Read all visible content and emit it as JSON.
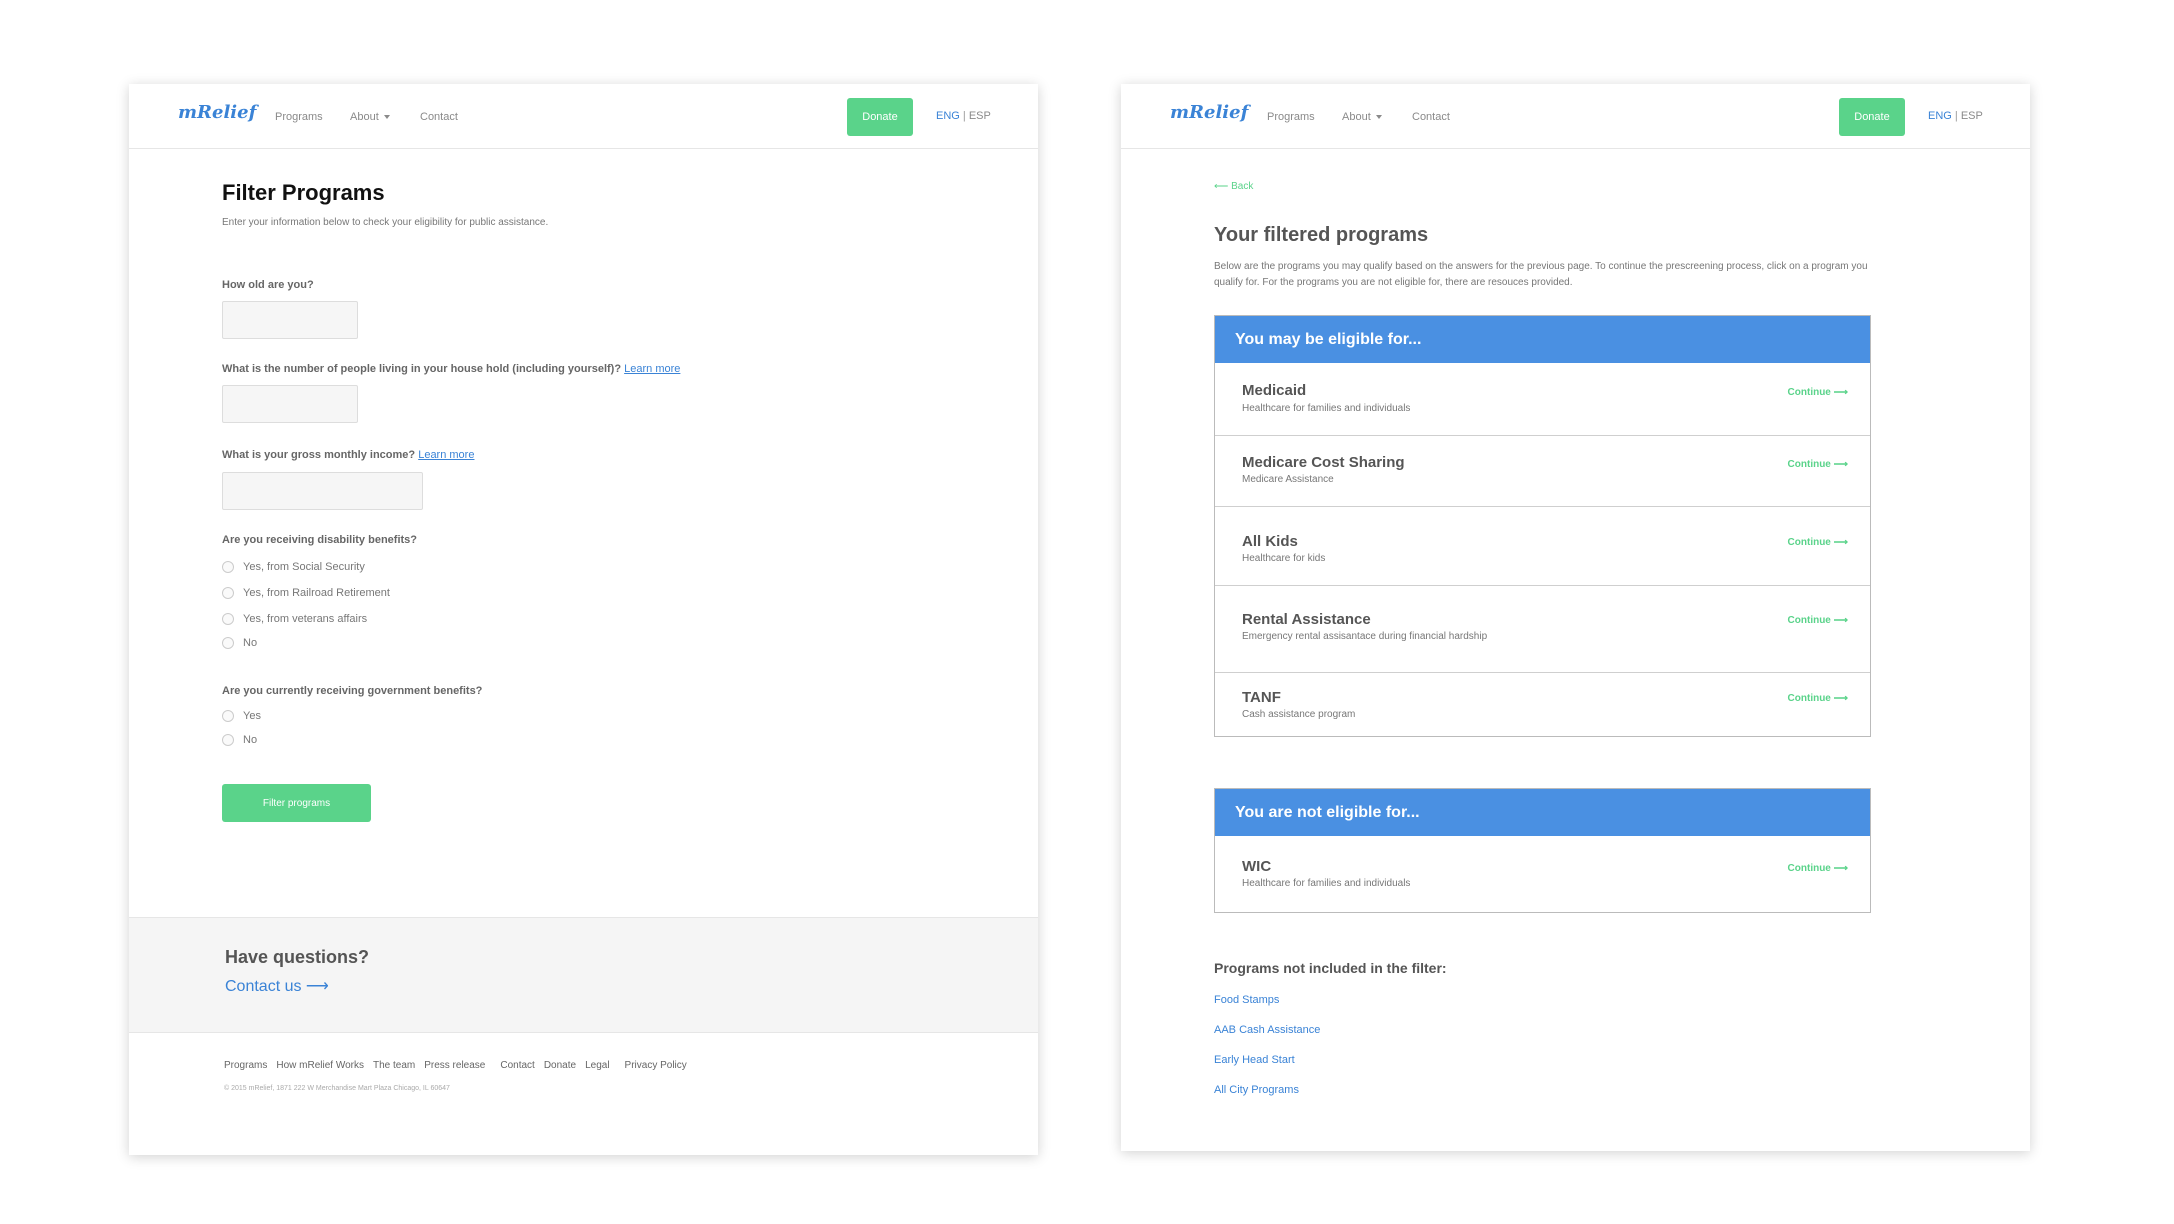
{
  "nav": {
    "logo": "mRelief",
    "programs": "Programs",
    "about": "About",
    "contact": "Contact",
    "donate": "Donate",
    "lang_eng": "ENG",
    "lang_sep": " | ",
    "lang_esp": "ESP"
  },
  "filter_page": {
    "title": "Filter Programs",
    "subtitle": "Enter your information below to check your eligibility for public assistance.",
    "q_age": "How old are you?",
    "q_household": "What is the number of people living in your house hold (including yourself)?",
    "q_income": "What is your gross monthly income?",
    "learn_more": "Learn more",
    "q_disability": "Are you receiving disability benefits?",
    "disability_options": [
      "Yes, from Social Security",
      "Yes, from Railroad Retirement",
      "Yes, from veterans affairs",
      "No"
    ],
    "q_gov": "Are you currently receiving government benefits?",
    "gov_options": [
      "Yes",
      "No"
    ],
    "filter_button": "Filter programs",
    "have_questions": "Have questions?",
    "contact_us": "Contact us ⟶",
    "footer_links": [
      "Programs",
      "How mRelief Works",
      "The team",
      "Press release",
      "Contact",
      "Donate",
      "Legal",
      "Privacy Policy"
    ],
    "copyright": "© 2015 mRelief, 1871 222 W Merchandise Mart Plaza Chicago, IL 60647"
  },
  "results_page": {
    "back": "⟵ Back",
    "title": "Your filtered programs",
    "description": "Below are the programs you may qualify based on the answers for the previous page. To continue the prescreening process, click on a program you qualify for. For the programs you are not eligible for, there are resouces provided.",
    "eligible_header": "You may be eligible for...",
    "eligible": [
      {
        "name": "Medicaid",
        "desc": "Healthcare for families and individuals",
        "action": "Continue ⟶"
      },
      {
        "name": "Medicare Cost Sharing",
        "desc": "Medicare Assistance",
        "action": "Continue ⟶"
      },
      {
        "name": "All Kids",
        "desc": "Healthcare for kids",
        "action": "Continue ⟶"
      },
      {
        "name": "Rental Assistance",
        "desc": "Emergency rental assisantace during financial hardship",
        "action": "Continue ⟶"
      },
      {
        "name": "TANF",
        "desc": "Cash assistance program",
        "action": "Continue ⟶"
      }
    ],
    "not_eligible_header": "You are not eligible for...",
    "not_eligible": [
      {
        "name": "WIC",
        "desc": "Healthcare for families and individuals",
        "action": "Continue ⟶"
      }
    ],
    "not_included_title": "Programs not included in the filter:",
    "not_included_links": [
      "Food Stamps",
      "AAB Cash Assistance",
      "Early Head Start",
      "All City Programs"
    ]
  }
}
